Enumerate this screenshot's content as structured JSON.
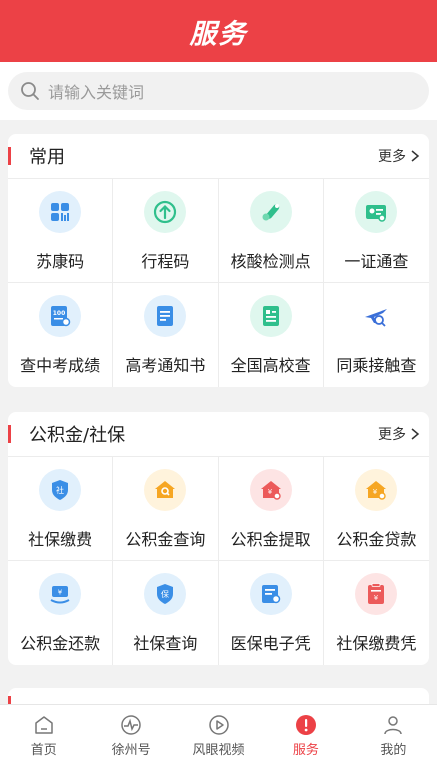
{
  "header": {
    "title": "服务"
  },
  "search": {
    "placeholder": "请输入关键词"
  },
  "colors": {
    "accent": "#ec4146"
  },
  "sections": [
    {
      "title": "常用",
      "more": "更多",
      "items": [
        {
          "label": "苏康码",
          "icon": "grid-qr-icon"
        },
        {
          "label": "行程码",
          "icon": "arrow-up-circle-icon"
        },
        {
          "label": "核酸检测点",
          "icon": "test-tube-icon"
        },
        {
          "label": "一证通查",
          "icon": "id-card-icon"
        },
        {
          "label": "查中考成绩",
          "icon": "score-100-icon"
        },
        {
          "label": "高考通知书",
          "icon": "notice-document-icon"
        },
        {
          "label": "全国高校查",
          "icon": "school-document-icon"
        },
        {
          "label": "同乘接触查",
          "icon": "plane-search-icon"
        }
      ]
    },
    {
      "title": "公积金/社保",
      "more": "更多",
      "items": [
        {
          "label": "社保缴费",
          "icon": "shield-she-icon"
        },
        {
          "label": "公积金查询",
          "icon": "house-search-icon"
        },
        {
          "label": "公积金提取",
          "icon": "house-withdraw-icon"
        },
        {
          "label": "公积金贷款",
          "icon": "house-loan-icon"
        },
        {
          "label": "公积金还款",
          "icon": "yen-repay-icon"
        },
        {
          "label": "社保查询",
          "icon": "shield-bao-icon"
        },
        {
          "label": "医保电子凭",
          "icon": "medical-card-icon"
        },
        {
          "label": "社保缴费凭",
          "icon": "receipt-icon"
        }
      ]
    }
  ],
  "nav": [
    {
      "label": "首页",
      "icon": "home-icon"
    },
    {
      "label": "徐州号",
      "icon": "pulse-icon"
    },
    {
      "label": "风眼视频",
      "icon": "play-icon"
    },
    {
      "label": "服务",
      "icon": "service-icon",
      "active": true
    },
    {
      "label": "我的",
      "icon": "user-icon"
    }
  ]
}
